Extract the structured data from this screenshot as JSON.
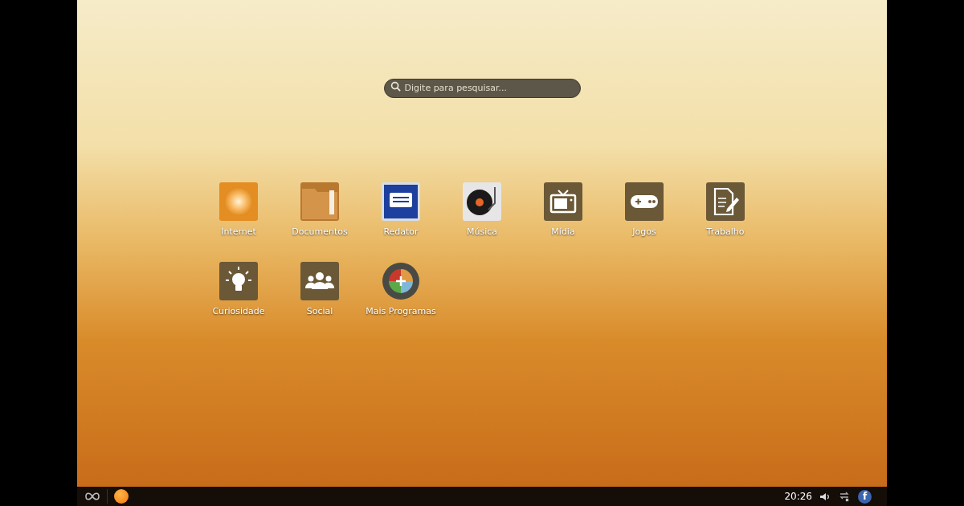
{
  "search": {
    "placeholder": "Digite para pesquisar..."
  },
  "apps": [
    {
      "label": "Internet",
      "kind": "sun"
    },
    {
      "label": "Documentos",
      "kind": "folder"
    },
    {
      "label": "Redator",
      "kind": "writer"
    },
    {
      "label": "Música",
      "kind": "vinyl"
    },
    {
      "label": "Mídia",
      "kind": "tv"
    },
    {
      "label": "Jogos",
      "kind": "gamepad"
    },
    {
      "label": "Trabalho",
      "kind": "document"
    },
    {
      "label": "Curiosidade",
      "kind": "bulb"
    },
    {
      "label": "Social",
      "kind": "people"
    },
    {
      "label": "Mais Programas",
      "kind": "add"
    }
  ],
  "taskbar": {
    "clock": "20:26",
    "facebook_label": "f"
  }
}
